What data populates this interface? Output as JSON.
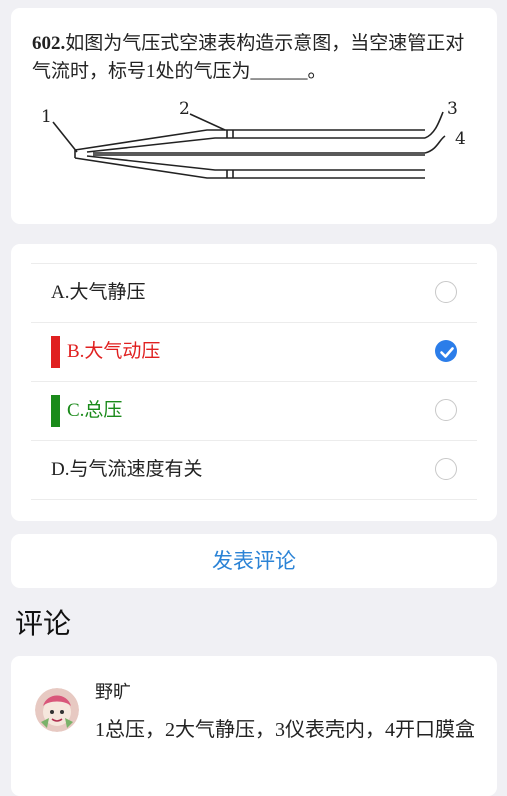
{
  "question": {
    "number": "602.",
    "text": "如图为气压式空速表构造示意图，当空速管正对气流时，标号1处的气压为______。",
    "diagram_labels": [
      "1",
      "2",
      "3",
      "4"
    ]
  },
  "options": [
    {
      "label": "A.大气静压",
      "state": "unselected",
      "color": "#222222"
    },
    {
      "label": "B.大气动压",
      "state": "selected-wrong",
      "color": "#e02020"
    },
    {
      "label": "C.总压",
      "state": "correct",
      "color": "#1a8a1a"
    },
    {
      "label": "D.与气流速度有关",
      "state": "unselected",
      "color": "#222222"
    }
  ],
  "comment_button": {
    "label": "发表评论"
  },
  "comments_heading": "评论",
  "comments": [
    {
      "user": "野旷",
      "text": "1总压，2大气静压，3仪表壳内，4开口膜盒",
      "avatar": "cartoon-avatar"
    }
  ]
}
